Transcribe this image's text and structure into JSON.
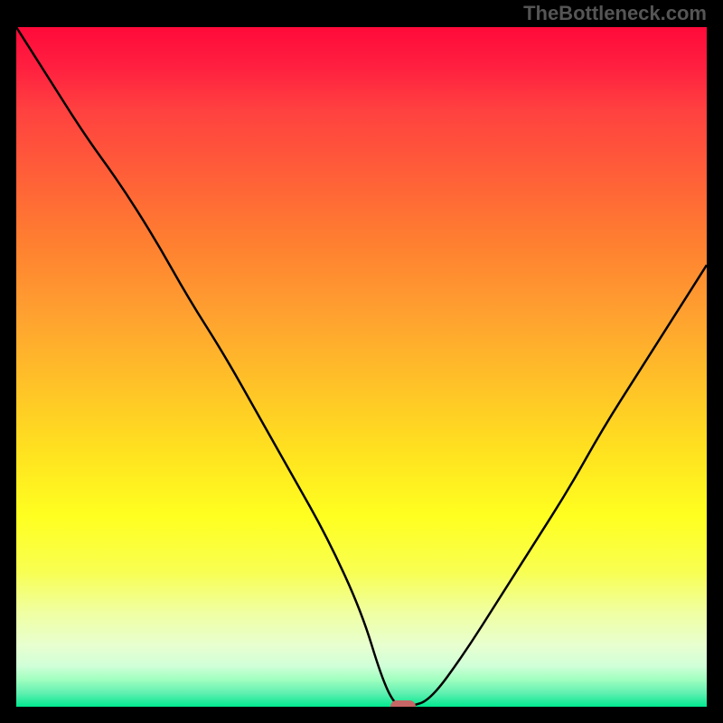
{
  "watermark": "TheBottleneck.com",
  "chart_data": {
    "type": "line",
    "title": "",
    "xlabel": "",
    "ylabel": "",
    "xlim": [
      0,
      100
    ],
    "ylim": [
      0,
      100
    ],
    "x": [
      0,
      5,
      10,
      15,
      20,
      25,
      30,
      35,
      40,
      45,
      50,
      53,
      55,
      57,
      60,
      65,
      70,
      75,
      80,
      85,
      90,
      95,
      100
    ],
    "values": [
      100,
      92,
      84,
      77,
      69,
      60,
      52,
      43,
      34,
      25,
      14,
      4,
      0,
      0,
      1,
      8,
      16,
      24,
      32,
      41,
      49,
      57,
      65
    ],
    "marker": {
      "x": 56,
      "y": 0
    },
    "background_gradient_stops": [
      {
        "pos": 0,
        "color": "#ff0a3a"
      },
      {
        "pos": 6,
        "color": "#ff2040"
      },
      {
        "pos": 12,
        "color": "#ff4040"
      },
      {
        "pos": 22,
        "color": "#ff6038"
      },
      {
        "pos": 32,
        "color": "#ff8030"
      },
      {
        "pos": 42,
        "color": "#ffa030"
      },
      {
        "pos": 52,
        "color": "#ffc028"
      },
      {
        "pos": 62,
        "color": "#ffe020"
      },
      {
        "pos": 72,
        "color": "#ffff20"
      },
      {
        "pos": 80,
        "color": "#f8ff50"
      },
      {
        "pos": 86,
        "color": "#f0ffa0"
      },
      {
        "pos": 91,
        "color": "#e8ffd0"
      },
      {
        "pos": 94,
        "color": "#d0ffd8"
      },
      {
        "pos": 96,
        "color": "#a0ffc0"
      },
      {
        "pos": 98,
        "color": "#60f0b0"
      },
      {
        "pos": 100,
        "color": "#00e890"
      }
    ]
  }
}
